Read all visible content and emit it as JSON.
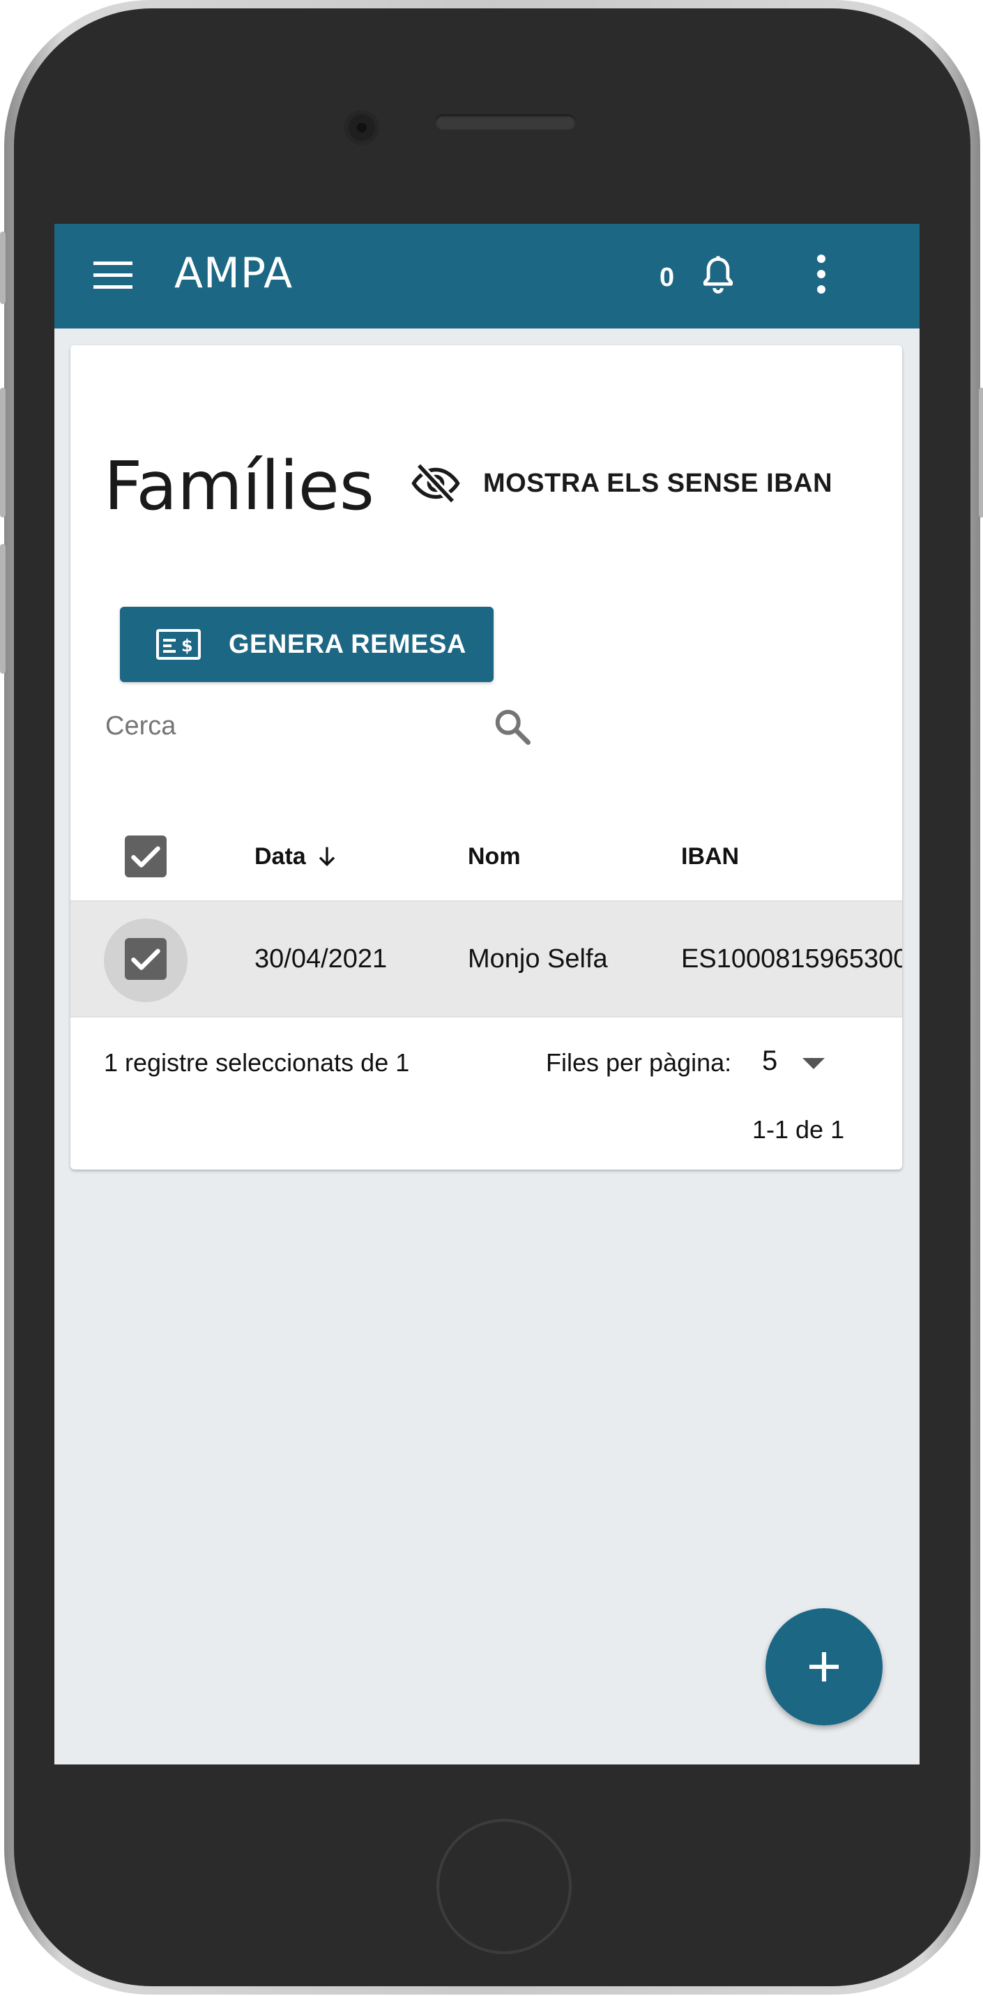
{
  "appbar": {
    "title": "AMPA",
    "notification_count": "0",
    "menu_icon": "hamburger-menu-icon",
    "bell_icon": "bell-icon",
    "more_icon": "more-vert-icon"
  },
  "page": {
    "title": "Famílies",
    "toggle_iban_label": "MOSTRA ELS SENSE IBAN",
    "toggle_iban_icon": "eye-off-icon",
    "generate_button_label": "GENERA REMESA",
    "generate_button_icon": "money-check-icon"
  },
  "search": {
    "placeholder": "Cerca",
    "value": ""
  },
  "table": {
    "columns": [
      "Data",
      "Nom",
      "IBAN"
    ],
    "sort_icon": "arrow-down-icon",
    "select_all_checked": true,
    "rows": [
      {
        "checked": true,
        "data": "30/04/2021",
        "nom": "Monjo Selfa",
        "iban": "ES1000815965300"
      }
    ]
  },
  "footer": {
    "selection_text": "1 registre seleccionats de 1",
    "rows_per_page_label": "Files per pàgina:",
    "rows_per_page_value": "5",
    "range_text": "1-1 de 1"
  },
  "fab": {
    "icon": "plus-icon"
  },
  "colors": {
    "primary": "#1c6784",
    "background": "#e9ecef",
    "checkbox": "#616161",
    "selected_row": "#e8e8e8"
  }
}
